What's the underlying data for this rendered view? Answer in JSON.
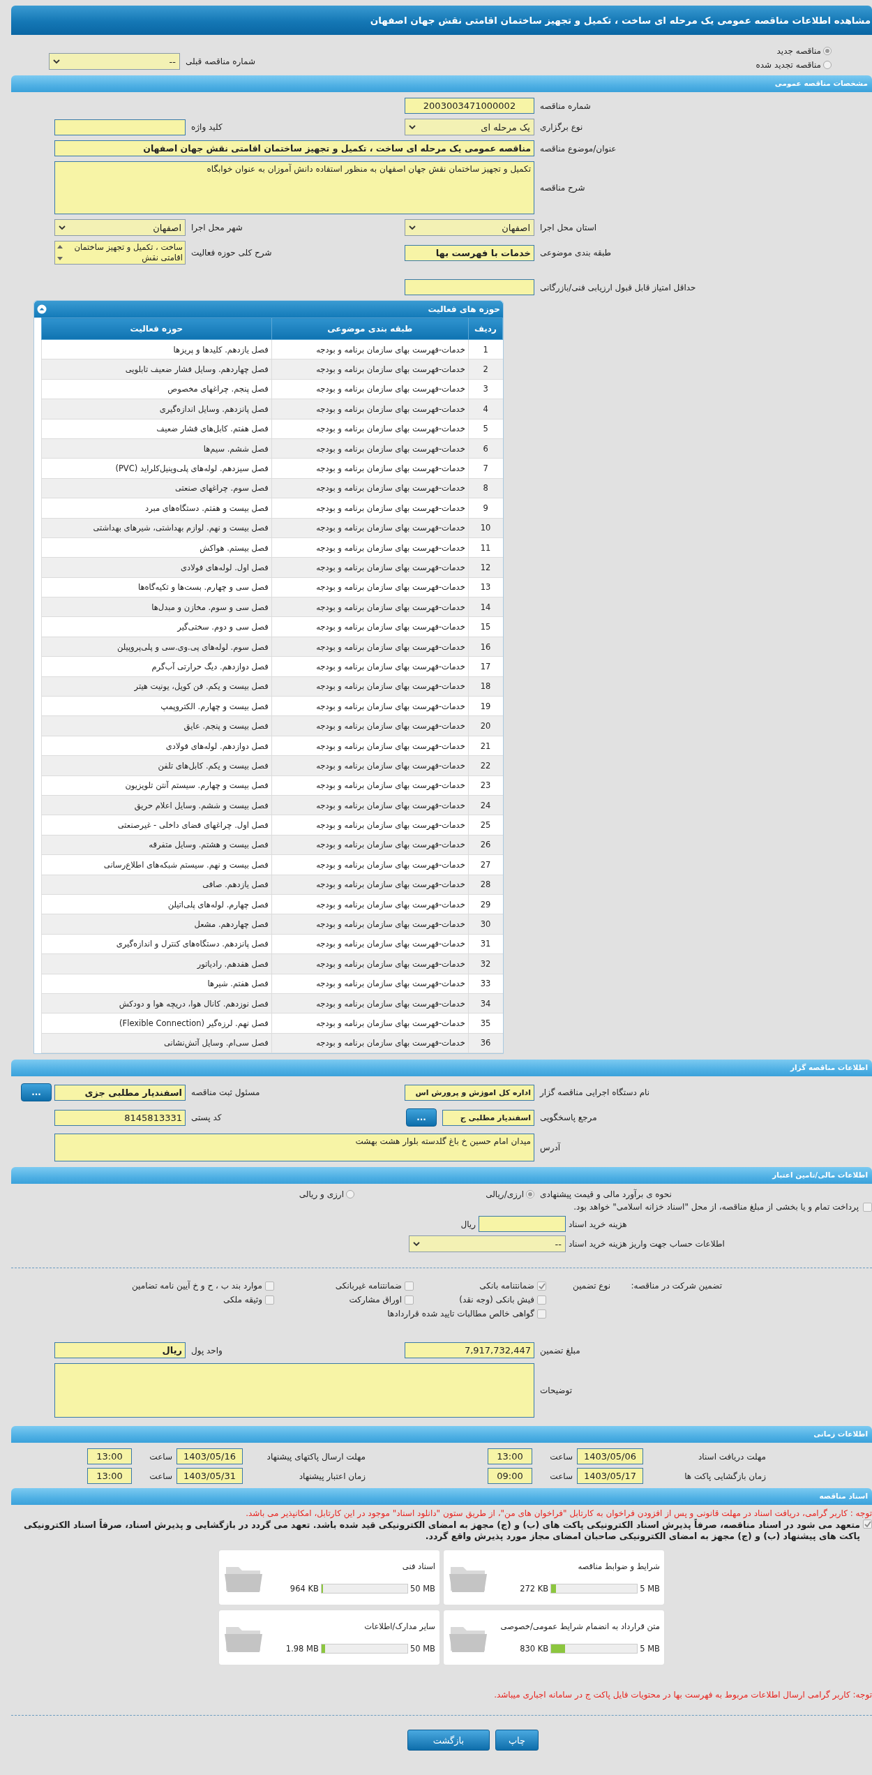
{
  "title": "مشاهده اطلاعات مناقصه عمومی یک مرحله ای ساخت ، تکمیل و تجهیز ساختمان اقامتی نقش جهان اصفهان",
  "tender_status": [
    {
      "label": "مناقصه جدید",
      "selected": true
    },
    {
      "label": "مناقصه تجدید شده",
      "selected": false
    }
  ],
  "previous_tender": {
    "label": "شماره مناقصه قبلی",
    "value": "--"
  },
  "general": {
    "heading": "مشخصات مناقصه عمومی",
    "tender_number": {
      "label": "شماره مناقصه",
      "value": "2003003471000002"
    },
    "holding_type": {
      "label": "نوع برگزاری",
      "value": "یک مرحله ای"
    },
    "keyword": {
      "label": "کلید واژه"
    },
    "subject": {
      "label": "عنوان/موضوع مناقصه",
      "value": "مناقصه عمومی یک مرحله ای ساخت ،  تکمیل و تجهیز ساختمان اقامتی  نقش جهان اصفهان"
    },
    "description": {
      "label": "شرح مناقصه",
      "value": "تکمیل و تجهیز ساختمان نقش جهان اصفهان به منظور استفاده دانش آموزان به عنوان خوابگاه"
    },
    "province": {
      "label": "استان محل اجرا",
      "value": "اصفهان"
    },
    "city": {
      "label": "شهر محل اجرا",
      "value": "اصفهان"
    },
    "category": {
      "label": "طبقه بندی موضوعی",
      "value": "خدمات با فهرست بها"
    },
    "activity_summary": {
      "label": "شرح کلی حوزه فعالیت",
      "value": "ساخت ،  تکمیل و تجهیز ساختمان اقامتی نقش"
    },
    "min_score": {
      "label": "حداقل امتیاز قابل قبول ارزیابی فنی/بازرگانی"
    }
  },
  "activities": {
    "heading": "حوزه های فعالیت",
    "columns": [
      "ردیف",
      "طبقه بندی موضوعی",
      "حوزه فعالیت"
    ],
    "rows": [
      {
        "number": "1",
        "category": "خدمات-فهرست بهای سازمان برنامه و بودجه",
        "scope": "فصل یازدهم. کلیدها و پریزها"
      },
      {
        "number": "2",
        "category": "خدمات-فهرست بهای سازمان برنامه و بودجه",
        "scope": "فصل چهاردهم. وسایل فشار ضعیف تابلویی"
      },
      {
        "number": "3",
        "category": "خدمات-فهرست بهای سازمان برنامه و بودجه",
        "scope": "فصل پنجم. چراغهای مخصوص"
      },
      {
        "number": "4",
        "category": "خدمات-فهرست بهای سازمان برنامه و بودجه",
        "scope": "فصل پانزدهم. وسایل اندازه‌گیری"
      },
      {
        "number": "5",
        "category": "خدمات-فهرست بهای سازمان برنامه و بودجه",
        "scope": "فصل هفتم. کابل‌های فشار ضعیف"
      },
      {
        "number": "6",
        "category": "خدمات-فهرست بهای سازمان برنامه و بودجه",
        "scope": "فصل ششم. سیم‌ها"
      },
      {
        "number": "7",
        "category": "خدمات-فهرست بهای سازمان برنامه و بودجه",
        "scope": "فصل سیزدهم. لوله‌های پلی‌وینیل‌کلراید (PVC)"
      },
      {
        "number": "8",
        "category": "خدمات-فهرست بهای سازمان برنامه و بودجه",
        "scope": "فصل سوم. چراغهای صنعتی"
      },
      {
        "number": "9",
        "category": "خدمات-فهرست بهای سازمان برنامه و بودجه",
        "scope": "فصل بیست و هفتم. دستگاه‌های مبرد"
      },
      {
        "number": "10",
        "category": "خدمات-فهرست بهای سازمان برنامه و بودجه",
        "scope": "فصل بیست و نهم. لوازم بهداشتی، شیرهای بهداشتی"
      },
      {
        "number": "11",
        "category": "خدمات-فهرست بهای سازمان برنامه و بودجه",
        "scope": "فصل بیستم. هواکش"
      },
      {
        "number": "12",
        "category": "خدمات-فهرست بهای سازمان برنامه و بودجه",
        "scope": "فصل اول. لوله‌های فولادی"
      },
      {
        "number": "13",
        "category": "خدمات-فهرست بهای سازمان برنامه و بودجه",
        "scope": "فصل سی و چهارم. بست‌ها و تکیه‌گاه‌ها"
      },
      {
        "number": "14",
        "category": "خدمات-فهرست بهای سازمان برنامه و بودجه",
        "scope": "فصل سی و سوم. مخازن و مبدل‌ها"
      },
      {
        "number": "15",
        "category": "خدمات-فهرست بهای سازمان برنامه و بودجه",
        "scope": "فصل سی و دوم. سختی‌گیر"
      },
      {
        "number": "16",
        "category": "خدمات-فهرست بهای سازمان برنامه و بودجه",
        "scope": "فصل سوم. لوله‌های پی.وی.سی و پلی‌پروپیلن"
      },
      {
        "number": "17",
        "category": "خدمات-فهرست بهای سازمان برنامه و بودجه",
        "scope": "فصل دوازدهم. دیگ حرارتی آب‌گرم"
      },
      {
        "number": "18",
        "category": "خدمات-فهرست بهای سازمان برنامه و بودجه",
        "scope": "فصل بیست و یکم. فن کویل، یونیت هیتر"
      },
      {
        "number": "19",
        "category": "خدمات-فهرست بهای سازمان برنامه و بودجه",
        "scope": "فصل بیست و چهارم. الکتروپمپ"
      },
      {
        "number": "20",
        "category": "خدمات-فهرست بهای سازمان برنامه و بودجه",
        "scope": "فصل بیست و پنجم. عایق"
      },
      {
        "number": "21",
        "category": "خدمات-فهرست بهای سازمان برنامه و بودجه",
        "scope": "فصل دوازدهم. لوله‌های فولادی"
      },
      {
        "number": "22",
        "category": "خدمات-فهرست بهای سازمان برنامه و بودجه",
        "scope": "فصل بیست و یکم. کابل‌های تلفن"
      },
      {
        "number": "23",
        "category": "خدمات-فهرست بهای سازمان برنامه و بودجه",
        "scope": "فصل بیست و چهارم. سیستم آنتن تلویزیون"
      },
      {
        "number": "24",
        "category": "خدمات-فهرست بهای سازمان برنامه و بودجه",
        "scope": "فصل بیست و ششم. وسایل اعلام حریق"
      },
      {
        "number": "25",
        "category": "خدمات-فهرست بهای سازمان برنامه و بودجه",
        "scope": "فصل اول. چراغهای فضای داخلی - غیرصنعتی"
      },
      {
        "number": "26",
        "category": "خدمات-فهرست بهای سازمان برنامه و بودجه",
        "scope": "فصل بیست و هشتم. وسایل متفرقه"
      },
      {
        "number": "27",
        "category": "خدمات-فهرست بهای سازمان برنامه و بودجه",
        "scope": "فصل بیست و نهم. سیستم شبکه‌های اطلاع‌رسانی"
      },
      {
        "number": "28",
        "category": "خدمات-فهرست بهای سازمان برنامه و بودجه",
        "scope": "فصل یازدهم. صافی"
      },
      {
        "number": "29",
        "category": "خدمات-فهرست بهای سازمان برنامه و بودجه",
        "scope": "فصل چهارم. لوله‌های پلی‌اتیلن"
      },
      {
        "number": "30",
        "category": "خدمات-فهرست بهای سازمان برنامه و بودجه",
        "scope": "فصل چهاردهم. مشعل"
      },
      {
        "number": "31",
        "category": "خدمات-فهرست بهای سازمان برنامه و بودجه",
        "scope": "فصل پانزدهم. دستگاه‌های کنترل و اندازه‌گیری"
      },
      {
        "number": "32",
        "category": "خدمات-فهرست بهای سازمان برنامه و بودجه",
        "scope": "فصل هفدهم. رادیاتور"
      },
      {
        "number": "33",
        "category": "خدمات-فهرست بهای سازمان برنامه و بودجه",
        "scope": "فصل هفتم. شیرها"
      },
      {
        "number": "34",
        "category": "خدمات-فهرست بهای سازمان برنامه و بودجه",
        "scope": "فصل نوزدهم. کانال هوا، دریچه هوا و دودکش"
      },
      {
        "number": "35",
        "category": "خدمات-فهرست بهای سازمان برنامه و بودجه",
        "scope": "فصل نهم. لرزه‌گیر (Flexible Connection)"
      },
      {
        "number": "36",
        "category": "خدمات-فهرست بهای سازمان برنامه و بودجه",
        "scope": "فصل سی‌ام. وسایل آتش‌نشانی"
      }
    ]
  },
  "organizer": {
    "heading": "اطلاعات مناقصه گزار",
    "executor": {
      "label": "نام دستگاه اجرایی مناقصه گزار",
      "value": "اداره کل اموزش و پرورش اس"
    },
    "registrar": {
      "label": "مسئول ثبت مناقصه",
      "value": "اسفندیار مطلبی جزی",
      "button": "..."
    },
    "responder": {
      "label": "مرجع پاسخگویی",
      "value": "اسفندیار مطلبی ج",
      "button": "..."
    },
    "postal_code": {
      "label": "کد پستی",
      "value": "8145813331"
    },
    "address": {
      "label": "آدرس",
      "value": "میدان امام حسین خ باغ گلدسته بلوار هشت بهشت"
    }
  },
  "finance": {
    "heading": "اطلاعات مالی/تامین اعتبار",
    "estimate": {
      "label": "نحوه ی برآورد مالی و قیمت پیشنهادی",
      "options": [
        {
          "label": "ارزی/ریالی",
          "selected": true
        },
        {
          "label": "ارزی و ریالی",
          "selected": false
        }
      ]
    },
    "treasury": {
      "label": "پرداخت تمام و یا بخشی از مبلغ مناقصه، از محل \"اسناد خزانه اسلامی\" خواهد بود.",
      "checked": false
    },
    "doc_fee": {
      "label": "هزینه خرید اسناد",
      "unit": "ریال"
    },
    "account": {
      "label": "اطلاعات حساب جهت واریز هزینه خرید اسناد",
      "value": "--"
    },
    "guarantee": {
      "label": "تضمین شرکت در مناقصه:",
      "type_label": "نوع تضمین",
      "options": [
        {
          "label": "ضمانتنامه بانکی",
          "checked": true
        },
        {
          "label": "ضمانتنامه غیربانکی",
          "checked": false
        },
        {
          "label": "موارد بند ب ، ح و خ آیین نامه تضامین",
          "checked": false
        },
        {
          "label": "فیش بانکی (وجه نقد)",
          "checked": false
        },
        {
          "label": "اوراق مشارکت",
          "checked": false
        },
        {
          "label": "وثیقه ملکی",
          "checked": false
        },
        {
          "label": "گواهی خالص مطالبات تایید شده قراردادها",
          "checked": false
        }
      ]
    },
    "amount": {
      "label": "مبلغ تضمین",
      "value": "7,917,732,447"
    },
    "currency": {
      "label": "واحد پول",
      "value": "ریال"
    },
    "notes": {
      "label": "توضیحات"
    }
  },
  "schedule": {
    "heading": "اطلاعات زمانی",
    "items": [
      {
        "label": "مهلت دریافت اسناد",
        "date": "1403/05/06",
        "time_label": "ساعت",
        "time": "13:00"
      },
      {
        "label": "مهلت ارسال پاکتهای پیشنهاد",
        "date": "1403/05/16",
        "time_label": "ساعت",
        "time": "13:00"
      },
      {
        "label": "زمان بازگشایی پاکت ها",
        "date": "1403/05/17",
        "time_label": "ساعت",
        "time": "09:00"
      },
      {
        "label": "زمان اعتبار پیشنهاد",
        "date": "1403/05/31",
        "time_label": "ساعت",
        "time": "13:00"
      }
    ]
  },
  "documents": {
    "heading": "اسناد مناقصه",
    "notice": "توجه : کاربر گرامی، دریافت اسناد در مهلت قانونی و پس از افزودن فراخوان به کارتابل \"فراخوان های من\"، از طریق ستون \"دانلود اسناد\" موجود در این کارتابل، امکانپذیر می باشد.",
    "commitment": {
      "checked": true,
      "text": "متعهد می شود در اسناد مناقصه، صرفاً پذیرش اسناد الکترونیکی پاکت های (ب) و (ج) مجهز به امضای الکترونیکی قید شده باشد. تعهد می گردد در بازگشایی و پذیرش اسناد، صرفاً اسناد الکترونیکی پاکت های پیشنهاد (ب) و (ج) مجهز به امضای الکترونیکی صاحبان امضای مجاز مورد پذیرش واقع گردد."
    },
    "files": [
      {
        "name": "شرایط و ضوابط مناقصه",
        "size": "272 KB",
        "limit": "5 MB",
        "level": 0.053
      },
      {
        "name": "اسناد فنی",
        "size": "964 KB",
        "limit": "50 MB",
        "level": 0.019
      },
      {
        "name": "متن قرارداد به انضمام شرایط عمومی/خصوصی",
        "size": "830 KB",
        "limit": "5 MB",
        "level": 0.162
      },
      {
        "name": "سایر مدارک/اطلاعات",
        "size": "1.98 MB",
        "limit": "50 MB",
        "level": 0.04
      }
    ],
    "footer_note": "توجه: کاربر گرامی ارسال اطلاعات مربوط به فهرست بها در محتویات فایل پاکت ج در سامانه اجباری میباشد."
  },
  "buttons": [
    "چاپ",
    "بازگشت"
  ]
}
